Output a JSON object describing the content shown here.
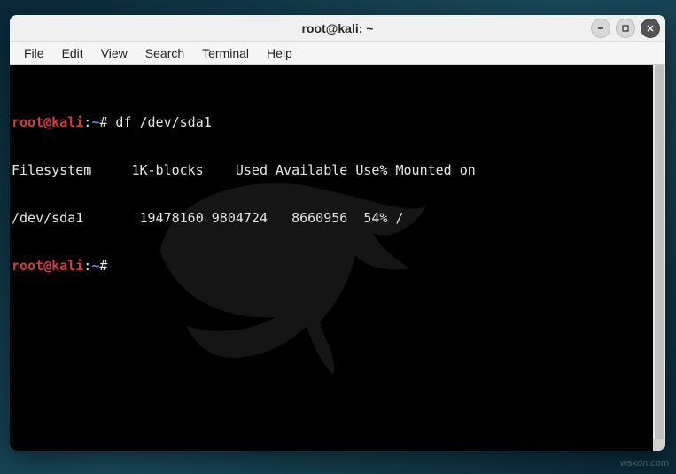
{
  "window": {
    "title": "root@kali: ~"
  },
  "menu": {
    "items": [
      "File",
      "Edit",
      "View",
      "Search",
      "Terminal",
      "Help"
    ]
  },
  "terminal": {
    "prompt": {
      "user_host": "root@kali",
      "sep": ":",
      "path": "~",
      "symbol": "#"
    },
    "command1": "df /dev/sda1",
    "output_header": "Filesystem     1K-blocks    Used Available Use% Mounted on",
    "output_row": "/dev/sda1       19478160 9804724   8660956  54% /"
  },
  "watermark": "wsxdn.com"
}
